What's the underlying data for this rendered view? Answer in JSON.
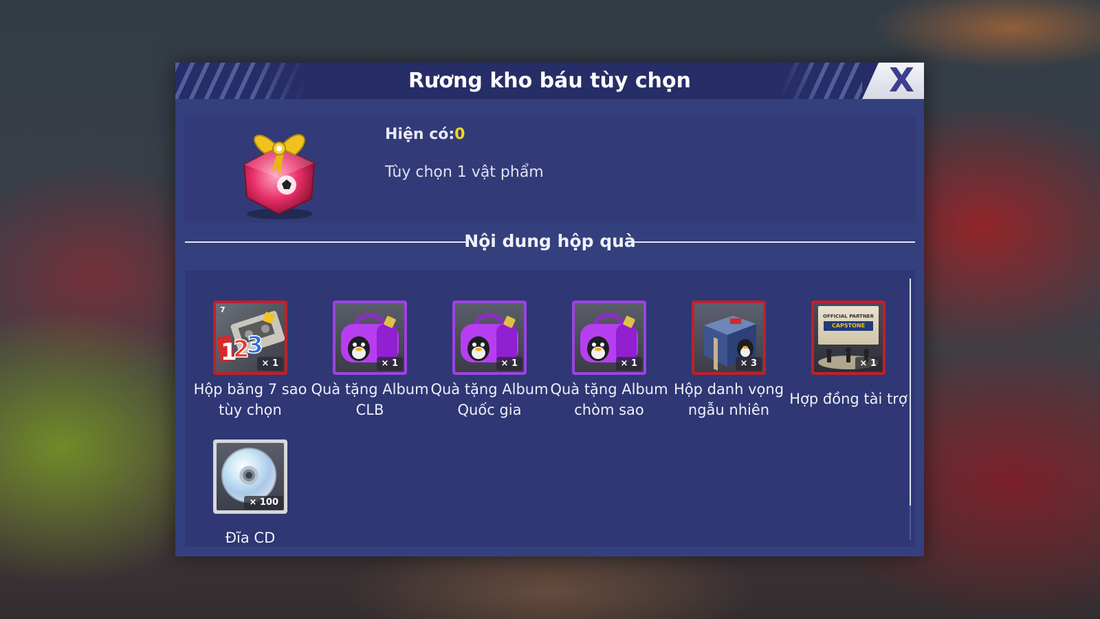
{
  "modal": {
    "title": "Rương kho báu tùy chọn",
    "close_label": "X"
  },
  "chest": {
    "owned_label": "Hiện có:",
    "owned_value": "0",
    "description": "Tùy chọn 1 vật phẩm"
  },
  "section": {
    "title": "Nội dung hộp quà"
  },
  "items": [
    {
      "name": "Hộp băng 7 sao tùy chọn",
      "line1": "Hộp băng 7 sao",
      "line2": "tùy chọn",
      "qty": "× 1",
      "icon": "cassette-box-icon",
      "frame": "red",
      "corner": "7"
    },
    {
      "name": "Quà tặng Album CLB",
      "line1": "Quà tặng Album",
      "line2": "CLB",
      "qty": "× 1",
      "icon": "purple-bag-icon",
      "frame": "purple"
    },
    {
      "name": "Quà tặng Album Quốc gia",
      "line1": "Quà tặng Album",
      "line2": "Quốc gia",
      "qty": "× 1",
      "icon": "purple-bag-icon",
      "frame": "purple"
    },
    {
      "name": "Quà tặng Album chòm sao",
      "line1": "Quà tặng Album",
      "line2": "chòm sao",
      "qty": "× 1",
      "icon": "purple-bag-icon",
      "frame": "purple"
    },
    {
      "name": "Hộp danh vọng ngẫu nhiên",
      "line1": "Hộp danh vọng",
      "line2": "ngẫu nhiên",
      "qty": "× 3",
      "icon": "mystery-box-icon",
      "frame": "red"
    },
    {
      "name": "Hợp đồng tài trợ",
      "line1": "Hợp đồng tài trợ",
      "qty": "× 1",
      "icon": "sponsor-contract-icon",
      "frame": "red",
      "banner_top": "OFFICIAL PARTNER",
      "banner_brand": "CAPSTONE"
    },
    {
      "name": "Đĩa CD",
      "line1": "Đĩa CD",
      "qty": "× 100",
      "icon": "cd-disc-icon",
      "frame": "white"
    }
  ]
}
